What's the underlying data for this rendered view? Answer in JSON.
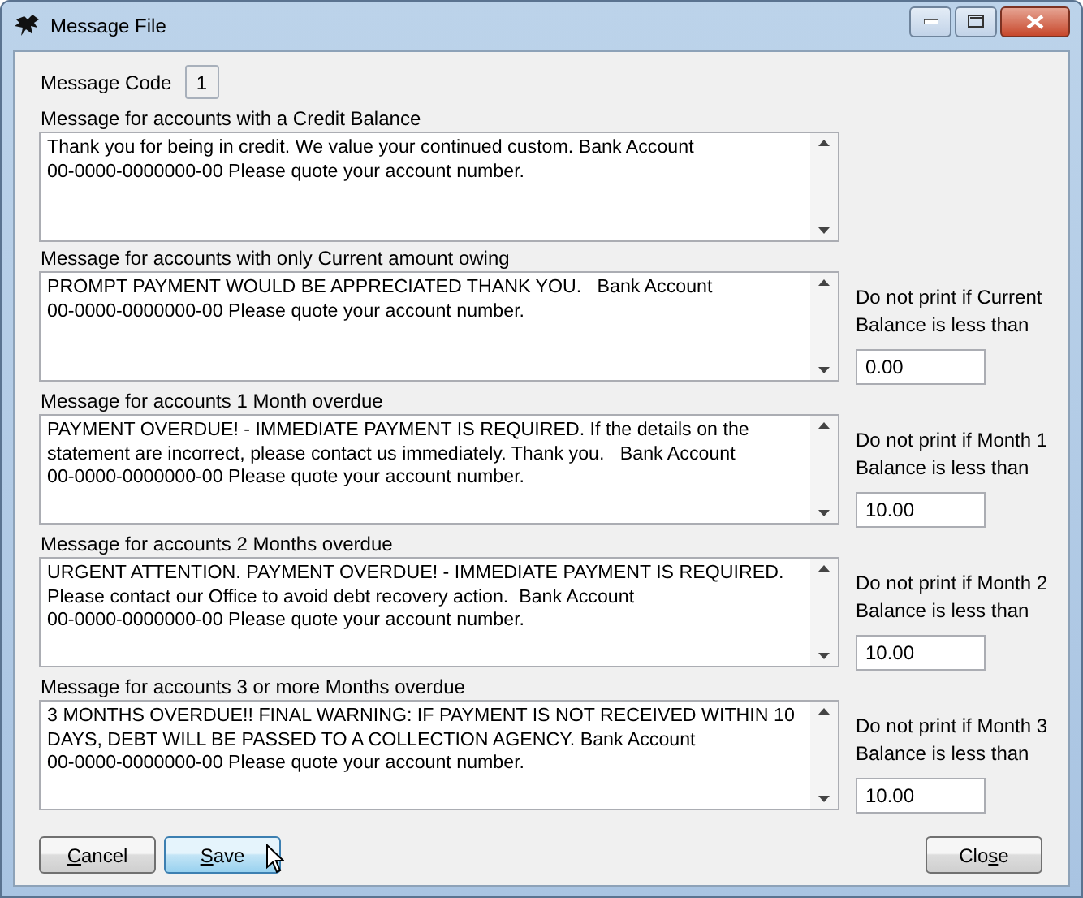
{
  "window": {
    "title": "Message File"
  },
  "message_code": {
    "label": "Message Code",
    "value": "1"
  },
  "sections": [
    {
      "label": "Message for accounts with a Credit Balance",
      "text": "Thank you for being in credit. We value your continued custom. Bank Account 00-0000-0000000-00 Please quote your account number."
    },
    {
      "label": "Message for accounts with only Current amount owing",
      "text": "PROMPT PAYMENT WOULD BE APPRECIATED THANK YOU.   Bank Account 00-0000-0000000-00 Please quote your account number.",
      "threshold_label": "Do not print if Current Balance is less than",
      "threshold": "0.00"
    },
    {
      "label": "Message for accounts 1 Month overdue",
      "text": "PAYMENT OVERDUE! - IMMEDIATE PAYMENT IS REQUIRED. If the details on the statement are incorrect, please contact us immediately. Thank you.   Bank Account 00-0000-0000000-00 Please quote your account number.",
      "threshold_label": "Do not print if Month 1 Balance is less than",
      "threshold": "10.00"
    },
    {
      "label": "Message for accounts 2 Months overdue",
      "text": "URGENT ATTENTION. PAYMENT OVERDUE! - IMMEDIATE PAYMENT IS REQUIRED. Please contact our Office to avoid debt recovery action.  Bank Account 00-0000-0000000-00 Please quote your account number.",
      "threshold_label": "Do not print if Month 2 Balance is less than",
      "threshold": "10.00"
    },
    {
      "label": "Message for accounts 3 or more Months overdue",
      "text": "3 MONTHS OVERDUE!! FINAL WARNING: IF PAYMENT IS NOT RECEIVED WITHIN 10 DAYS, DEBT WILL BE PASSED TO A COLLECTION AGENCY. Bank Account 00-0000-0000000-00 Please quote your account number.",
      "threshold_label": "Do not print if Month 3 Balance is less than",
      "threshold": "10.00"
    }
  ],
  "buttons_left": [
    {
      "key": "C",
      "after": "ancel",
      "focused": false
    },
    {
      "key": "S",
      "after": "ave",
      "focused": true
    }
  ],
  "buttons_right": [
    {
      "before": "Clo",
      "key": "s",
      "after": "e",
      "focused": false
    }
  ]
}
